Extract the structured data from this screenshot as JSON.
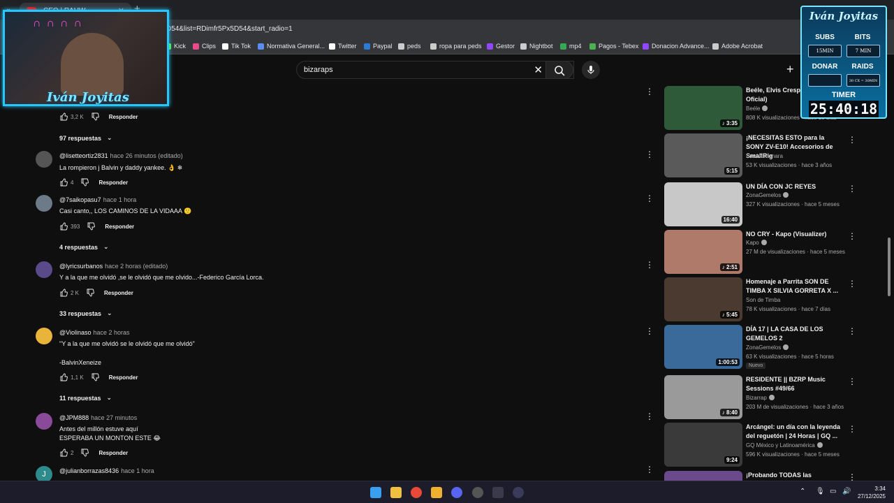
{
  "browser": {
    "tab_title": "CEO | RAUW",
    "url": "D54&list=RDimfr5Px5D54&start_radio=1",
    "bookmarks": [
      {
        "label": "Kick",
        "color": "#53fc18"
      },
      {
        "label": "Clips",
        "color": "#e84a8a"
      },
      {
        "label": "Tik Tok",
        "color": "#ffffff"
      },
      {
        "label": "Normativa General...",
        "color": "#5b8def"
      },
      {
        "label": "Twitter",
        "color": "#ffffff"
      },
      {
        "label": "Paypal",
        "color": "#2a7bd6"
      },
      {
        "label": "peds",
        "color": "#cccccc"
      },
      {
        "label": "ropa para peds",
        "color": "#cccccc"
      },
      {
        "label": "Gestor",
        "color": "#9146ff"
      },
      {
        "label": "Nightbot",
        "color": "#cccccc"
      },
      {
        "label": "mp4",
        "color": "#34a853"
      },
      {
        "label": "Pagos - Tebex",
        "color": "#4caf50"
      },
      {
        "label": "Donacion Advance...",
        "color": "#9146ff"
      },
      {
        "label": "Adobe Acrobat",
        "color": "#cccccc"
      }
    ]
  },
  "search": {
    "query": "bizaraps"
  },
  "comments": {
    "top_partial": {
      "likes": "3,2 K",
      "reply_label": "Responder",
      "replies_label": "97 respuestas"
    },
    "items": [
      {
        "author": "@lisetteortiz2831",
        "time": "hace 26 minutos (editado)",
        "lines": [
          "La rompieron j Balvin y daddy yankee. 👌 ❄"
        ],
        "likes": "4",
        "reply_label": "Responder",
        "replies_label": "",
        "avatar_color": "#555555"
      },
      {
        "author": "@7saikopasu7",
        "time": "hace 1 hora",
        "lines": [
          "Casi canto,, LOS CAMINOS DE LA VIDAAA 🙁"
        ],
        "likes": "393",
        "reply_label": "Responder",
        "replies_label": "4 respuestas",
        "avatar_color": "#6d7a88"
      },
      {
        "author": "@lyricsurbanos",
        "time": "hace 2 horas (editado)",
        "lines": [
          "Y a la que me olvidó ,se le olvidó que me olvido...-Federico García Lorca."
        ],
        "likes": "2 K",
        "reply_label": "Responder",
        "replies_label": "33 respuestas",
        "avatar_color": "#5a4a8a"
      },
      {
        "author": "@Violinaso",
        "time": "hace 2 horas",
        "lines": [
          "\"Y a la que me olvidó se le olvidó que me olvidó\"",
          "",
          "-BalvinXeneize"
        ],
        "likes": "1,1 K",
        "reply_label": "Responder",
        "replies_label": "11 respuestas",
        "avatar_color": "#e8b43a"
      },
      {
        "author": "@JPM888",
        "time": "hace 27 minutos",
        "lines": [
          "Antes del millón estuve aquí",
          "ESPERABA UN MONTON ESTE 😂"
        ],
        "likes": "2",
        "reply_label": "Responder",
        "replies_label": "",
        "avatar_color": "#8a4a9a"
      },
      {
        "author": "@julianborrazas8436",
        "time": "hace 1 hora",
        "lines": [],
        "likes": "",
        "reply_label": "",
        "replies_label": "",
        "avatar_color": "#2e8b8b",
        "avatar_letter": "J"
      }
    ]
  },
  "sidebar": {
    "videos": [
      {
        "title": "Beéle, Elvis Crespo (Video Oficial)",
        "channel": "Beéle",
        "verified": true,
        "meta": "808 K visualizaciones · hace 10 días",
        "duration": "3:35",
        "music": true,
        "thumb": "#2e5a3a",
        "badge": ""
      },
      {
        "title": "¡NECESITAS ESTO para la SONY ZV-E10! Accesorios de SmallRig",
        "channel": "Srod Almenara",
        "verified": false,
        "meta": "53 K visualizaciones · hace 3 años",
        "duration": "5:15",
        "music": false,
        "thumb": "#5a5a5a",
        "badge": ""
      },
      {
        "title": "UN DÍA CON JC REYES",
        "channel": "ZonaGemelos",
        "verified": true,
        "meta": "327 K visualizaciones · hace 5 meses",
        "duration": "16:40",
        "music": false,
        "thumb": "#c8c8c8",
        "badge": ""
      },
      {
        "title": "NO CRY - Kapo (Visualizer)",
        "channel": "Kapo",
        "verified": true,
        "meta": "27 M de visualizaciones · hace 5 meses",
        "duration": "2:51",
        "music": true,
        "thumb": "#b07a6a",
        "badge": ""
      },
      {
        "title": "Homenaje a Parrita SON DE TIMBA X SILVIA GORRETA X ...",
        "channel": "Son de Timba",
        "verified": false,
        "meta": "78 K visualizaciones · hace 7 días",
        "duration": "5:45",
        "music": true,
        "thumb": "#4a3a30",
        "badge": ""
      },
      {
        "title": "DÍA 17 | LA CASA DE LOS GEMELOS 2",
        "channel": "ZonaGemelos",
        "verified": true,
        "meta": "63 K visualizaciones · hace 5 horas",
        "duration": "1:00:53",
        "music": false,
        "thumb": "#3a6a9a",
        "badge": "Nuevo"
      },
      {
        "title": "RESIDENTE || BZRP Music Sessions #49/66",
        "channel": "Bizarrap",
        "verified": true,
        "meta": "203 M de visualizaciones · hace 3 años",
        "duration": "8:40",
        "music": true,
        "thumb": "#9a9a9a",
        "badge": ""
      },
      {
        "title": "Arcángel: un día con la leyenda del reguetón | 24 Horas | GQ ...",
        "channel": "GQ México y Latinoamérica",
        "verified": true,
        "meta": "596 K visualizaciones · hace 5 meses",
        "duration": "9:24",
        "music": false,
        "thumb": "#3a3a3a",
        "badge": ""
      },
      {
        "title": "¡Probando TODAS las",
        "channel": "",
        "verified": false,
        "meta": "",
        "duration": "",
        "music": false,
        "thumb": "#6a4a8a",
        "badge": ""
      }
    ]
  },
  "overlay": {
    "cam_name": "Iván Joyitas",
    "panel": {
      "title": "Iván Joyitas",
      "subs_label": "SUBS",
      "subs_value": "15MIN",
      "bits_label": "BITS",
      "bits_value": "7 MIN",
      "donar_label": "DONAR",
      "donar_value": "",
      "raids_label": "RAIDS",
      "raids_value": "30 CX = 30MIN",
      "timer_label": "TIMER",
      "timer_value": "25:40:18"
    }
  },
  "taskbar": {
    "time": "3:34",
    "date": "27/12/2025"
  }
}
